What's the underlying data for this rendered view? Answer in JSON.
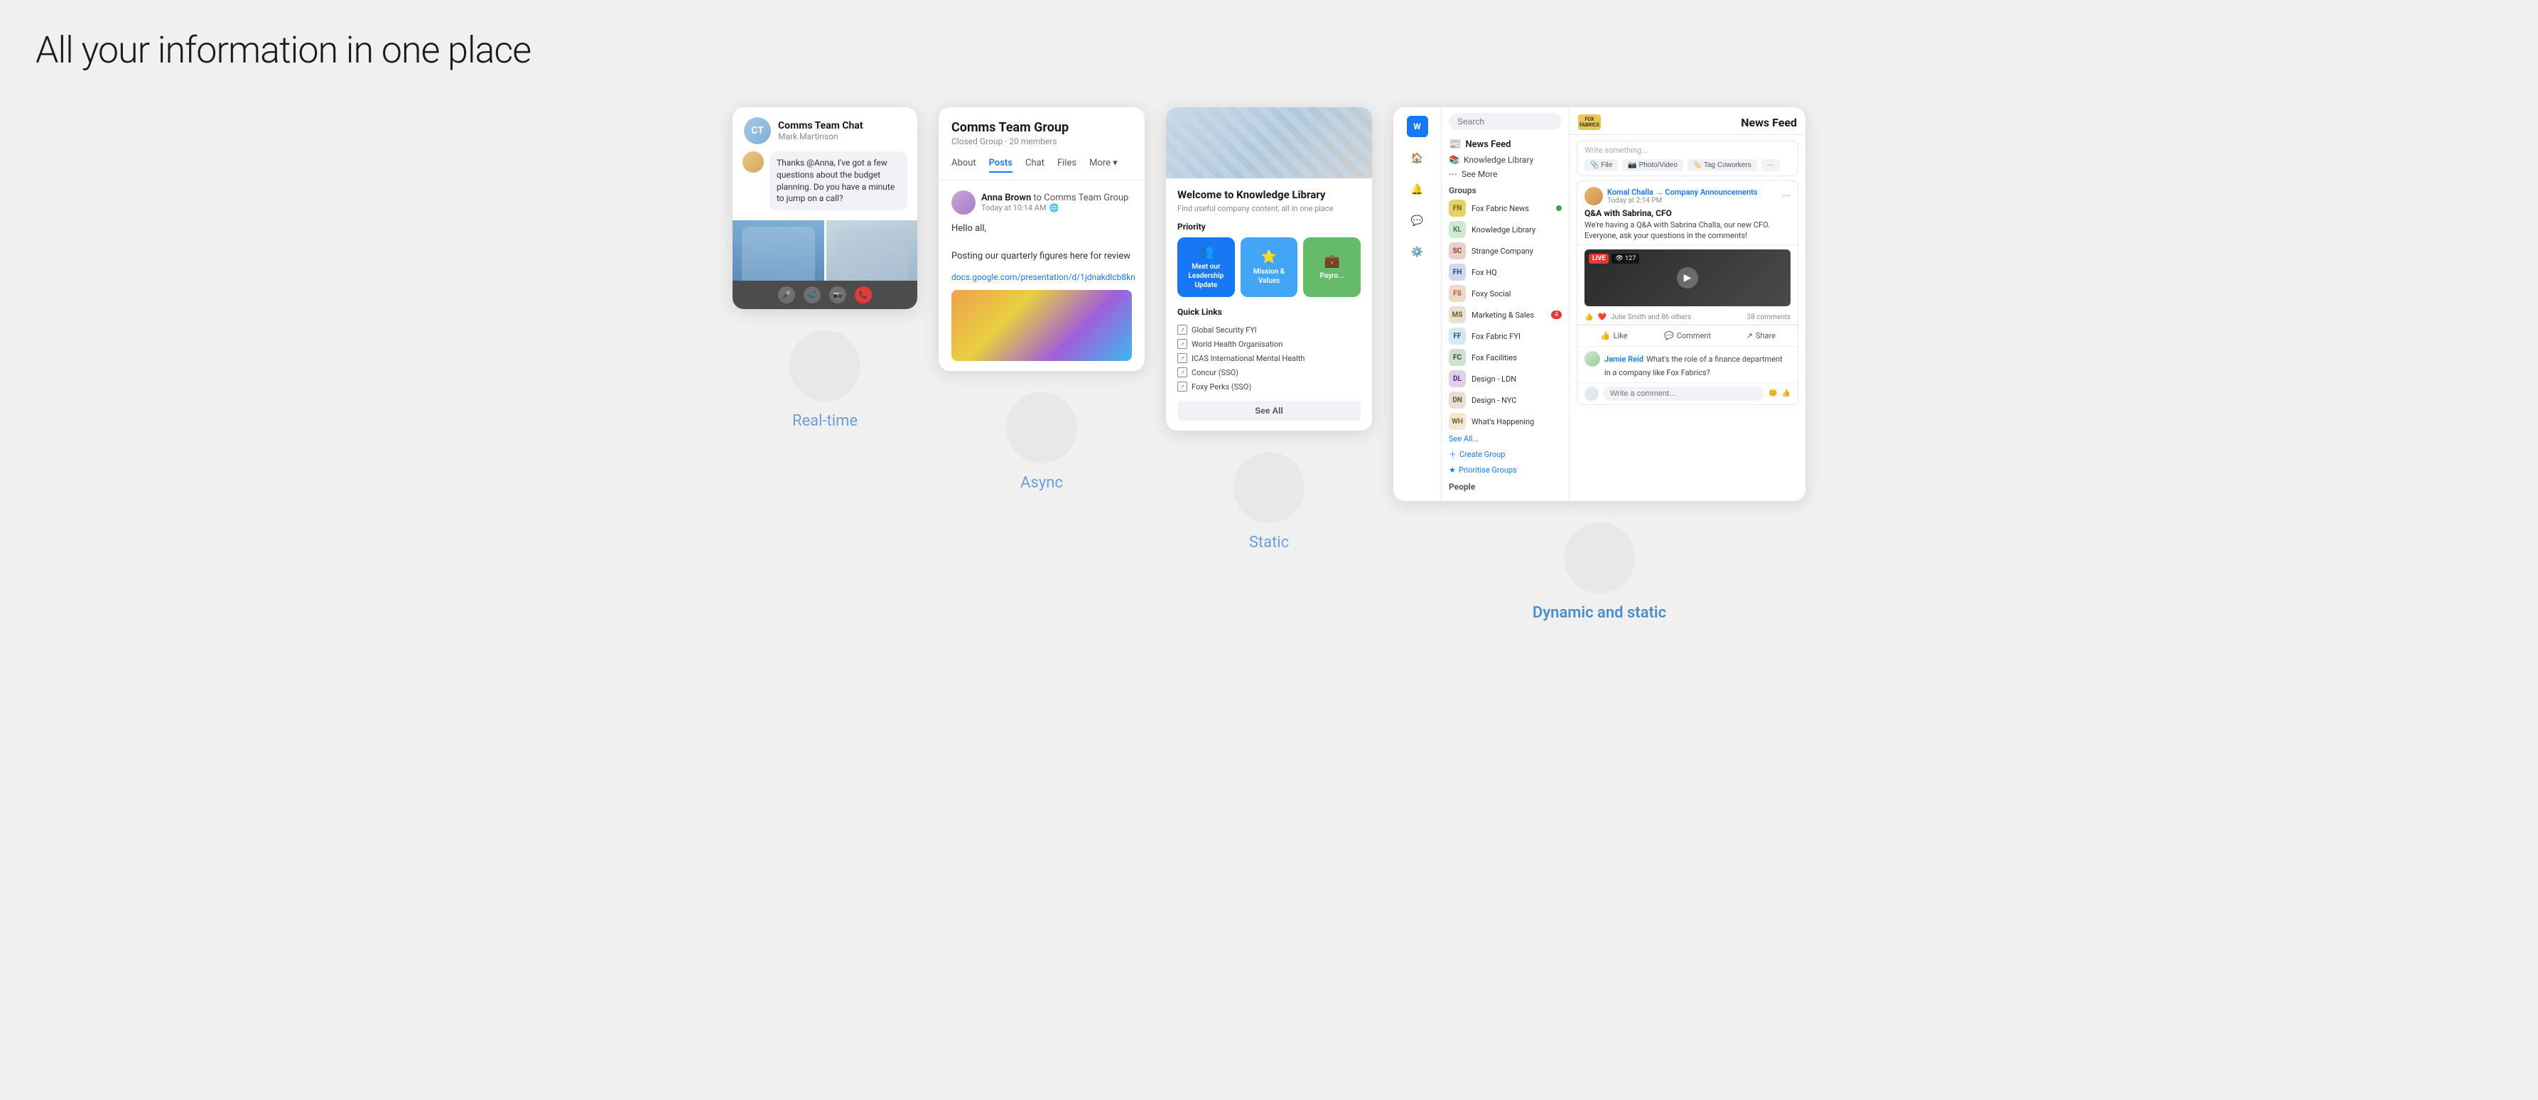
{
  "page": {
    "title": "All your information in one place",
    "background": "#f0f0f0"
  },
  "card1": {
    "title": "Comms Team Chat",
    "subtitle": "Mark Martinson",
    "message": "Thanks @Anna, I've got a few questions about the budget planning. Do you have a minute to jump on a call?",
    "controls": [
      "mic",
      "video",
      "camera",
      "end"
    ]
  },
  "card2": {
    "title": "Comms Team Group",
    "subtitle": "Closed Group · 20 members",
    "tabs": [
      "About",
      "Posts",
      "Chat",
      "Files",
      "More"
    ],
    "active_tab": "Posts",
    "post": {
      "author": "Anna Brown",
      "to": "Comms Team Group",
      "time": "Today at 10:14 AM",
      "text": "Hello all,\n\nPosting our quarterly figures here for review",
      "link": "docs.google.com/presentation/d/1jdnakdlcb8kn"
    }
  },
  "card3": {
    "title": "Welcome to Knowledge Library",
    "subtitle": "Find useful company content, all in one place",
    "priority_label": "Priority",
    "tiles": [
      {
        "label": "Meet our Leadership Update",
        "color": "blue"
      },
      {
        "label": "Mission & Values",
        "color": "blue-light"
      },
      {
        "label": "Payro...",
        "color": "green"
      }
    ],
    "quick_links_label": "Quick Links",
    "links": [
      "Global Security FYI",
      "World Health Organisation",
      "ICAS International Mental Health",
      "Concur (SSO)",
      "Foxy Perks (SSO)"
    ],
    "see_all_label": "See All"
  },
  "card4": {
    "search_placeholder": "Search",
    "brand_name": "FOX FABRICS",
    "feed_title": "News Feed",
    "compose_placeholder": "Write something...",
    "compose_btns": [
      "File",
      "Photo/Video",
      "Tag Coworkers"
    ],
    "groups_label": "Groups",
    "groups": [
      {
        "name": "Fox Fabric News",
        "badge": ""
      },
      {
        "name": "Knowledge Library",
        "badge": ""
      },
      {
        "name": "See More",
        "badge": ""
      },
      {
        "name": "Strange Company",
        "badge": ""
      },
      {
        "name": "Fox HQ",
        "badge": ""
      },
      {
        "name": "Foxy Social",
        "badge": ""
      },
      {
        "name": "Marketing & Sales",
        "badge": ""
      },
      {
        "name": "Fox Fabric FYI",
        "badge": ""
      },
      {
        "name": "Fox Facilities",
        "badge": ""
      },
      {
        "name": "Design - LDN",
        "badge": ""
      },
      {
        "name": "Design - NYC",
        "badge": ""
      },
      {
        "name": "What's Happening",
        "badge": ""
      }
    ],
    "see_all_label": "See All...",
    "create_group_label": "Create Group",
    "prioritise_label": "Prioritise Groups",
    "people_label": "People",
    "qa_post": {
      "author": "Komal Challa → Company Announcements",
      "time": "Today at 2:14 PM",
      "title": "Q&A with Sabrina, CFO",
      "text": "We're having a Q&A with Sabrina Challa, our new CFO. Everyone, ask your questions in the comments!"
    },
    "comment": {
      "author": "Jamie Reid",
      "text": "What's the role of a finance department in a company like Fox Fabrics?"
    }
  },
  "labels": [
    {
      "text": "Real-time",
      "active": false
    },
    {
      "text": "Async",
      "active": false
    },
    {
      "text": "Static",
      "active": false
    },
    {
      "text": "Dynamic and static",
      "active": true
    }
  ]
}
